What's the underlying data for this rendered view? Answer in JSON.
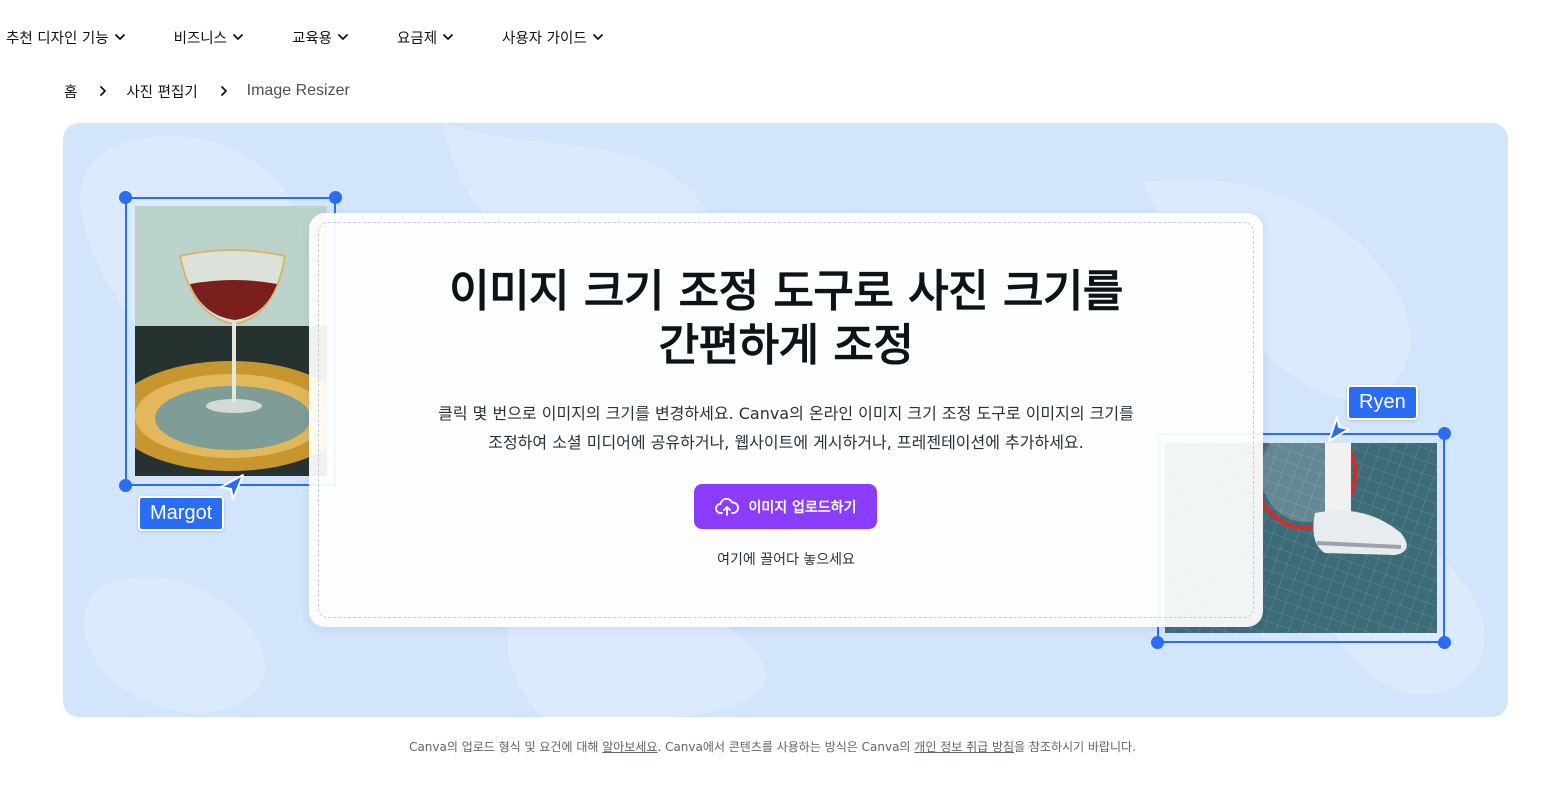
{
  "nav": {
    "items": [
      {
        "label": "추천 디자인 기능"
      },
      {
        "label": "비즈니스"
      },
      {
        "label": "교육용"
      },
      {
        "label": "요금제"
      },
      {
        "label": "사용자 가이드"
      }
    ]
  },
  "breadcrumb": {
    "home": "홈",
    "parent": "사진 편집기",
    "current": "Image Resizer"
  },
  "hero": {
    "title_line1": "이미지 크기 조정 도구로 사진 크기를",
    "title_line2": "간편하게 조정",
    "desc_line1": "클릭 몇 번으로 이미지의 크기를 변경하세요. Canva의 온라인 이미지 크기 조정 도구로 이미지의 크기를",
    "desc_line2": "조정하여 소셜 미디어에 공유하거나, 웹사이트에 게시하거나, 프레젠테이션에 추가하세요.",
    "upload_button": "이미지 업로드하기",
    "drop_text": "여기에 끌어다 놓으세요",
    "left_tag": "Margot",
    "right_tag": "Ryen"
  },
  "footer": {
    "part1": "Canva의 업로드 형식 및 요건에 대해 ",
    "link1": "알아보세요",
    "part2": ". Canva에서 콘텐츠를 사용하는 방식은 Canva의 ",
    "link2": "개인 정보 취급 방침",
    "part3": "을 참조하시기 바랍니다."
  },
  "colors": {
    "accent_purple": "#8b3dff",
    "selection_blue": "#2a6df4",
    "hero_bg": "#d2e5fc"
  },
  "icons": {
    "nav_dropdown": "chevron-down-icon",
    "breadcrumb_separator": "chevron-right-icon",
    "upload": "cloud-upload-icon",
    "pointer": "cursor-arrow-icon"
  }
}
